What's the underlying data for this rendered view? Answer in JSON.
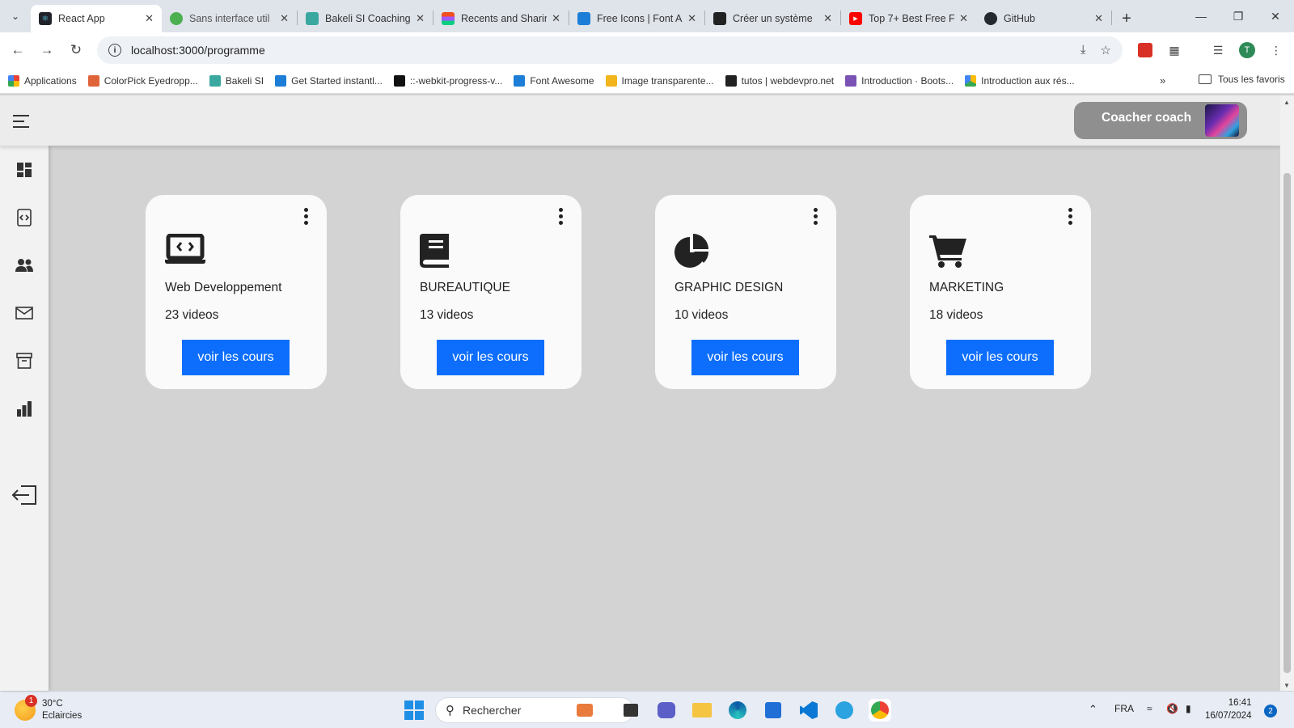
{
  "browser": {
    "tabs": [
      {
        "title": "React App",
        "favicon_color": "#20232a",
        "active": true
      },
      {
        "title": "Sans interface util",
        "favicon_color": "#4caf50"
      },
      {
        "title": "Bakeli SI Coaching",
        "favicon_color": "#3aa8a0"
      },
      {
        "title": "Recents and Sharin",
        "favicon_color": "#f24e1e"
      },
      {
        "title": "Free Icons | Font A",
        "favicon_color": "#1c7ed6"
      },
      {
        "title": "Créer un système",
        "favicon_color": "#222222"
      },
      {
        "title": "Top 7+ Best Free F",
        "favicon_color": "#ff0000"
      },
      {
        "title": "GitHub",
        "favicon_color": "#24292f"
      }
    ],
    "new_tab_label": "+",
    "url": "localhost:3000/programme",
    "profile_initial": "T",
    "bookmarks": [
      {
        "label": "Applications",
        "color": "#4285f4"
      },
      {
        "label": "ColorPick Eyedropp...",
        "color": "#e0643a"
      },
      {
        "label": "Bakeli SI",
        "color": "#3aa8a0"
      },
      {
        "label": "Get Started instantl...",
        "color": "#1c7ed6"
      },
      {
        "label": "::-webkit-progress-v...",
        "color": "#111111"
      },
      {
        "label": "Font Awesome",
        "color": "#1c7ed6"
      },
      {
        "label": "Image transparente...",
        "color": "#f2b51c"
      },
      {
        "label": "tutos | webdevpro.net",
        "color": "#222222"
      },
      {
        "label": "Introduction · Boots...",
        "color": "#7952b3"
      },
      {
        "label": "Introduction aux rés...",
        "color": "#34a853"
      }
    ],
    "bookmarks_more": "»",
    "all_bookmarks": "Tous les favoris"
  },
  "app": {
    "user_name": "Coacher coach",
    "sidebar_items": [
      "dashboard",
      "code-file",
      "users",
      "mail",
      "archive",
      "bar-chart"
    ],
    "logout": "logout",
    "cards": [
      {
        "title": "Web Developpement",
        "count": "23 videos",
        "button": "voir les cours",
        "icon": "laptop-code-icon"
      },
      {
        "title": "BUREAUTIQUE",
        "count": "13 videos",
        "button": "voir les cours",
        "icon": "book-icon"
      },
      {
        "title": "GRAPHIC DESIGN",
        "count": "10 videos",
        "button": "voir les cours",
        "icon": "pie-chart-icon"
      },
      {
        "title": "MARKETING",
        "count": "18 videos",
        "button": "voir les cours",
        "icon": "cart-icon"
      }
    ],
    "accent_color": "#0d6efd"
  },
  "taskbar": {
    "weather_temp": "30°C",
    "weather_desc": "Eclaircies",
    "weather_badge": "1",
    "search_placeholder": "Rechercher",
    "language": "FRA",
    "time": "16:41",
    "date": "16/07/2024",
    "notifications": "2"
  }
}
